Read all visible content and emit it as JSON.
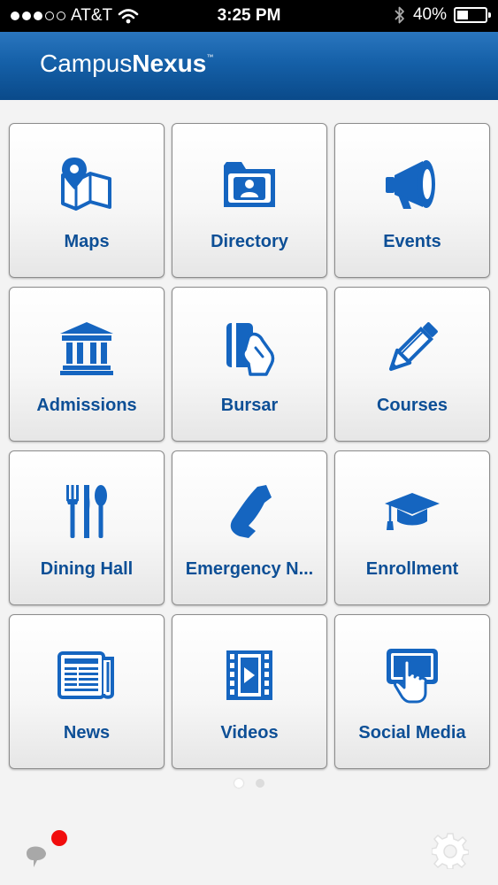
{
  "status_bar": {
    "carrier": "AT&T",
    "time": "3:25 PM",
    "battery": "40%",
    "battery_level": 0.4,
    "signal_bars": 3,
    "signal_total": 5
  },
  "header": {
    "brand_regular": "Campus",
    "brand_bold": "Nexus",
    "trademark": "™"
  },
  "tiles": [
    {
      "label": "Maps",
      "icon": "map-icon"
    },
    {
      "label": "Directory",
      "icon": "directory-folder-icon"
    },
    {
      "label": "Events",
      "icon": "megaphone-icon"
    },
    {
      "label": "Admissions",
      "icon": "building-icon"
    },
    {
      "label": "Bursar",
      "icon": "card-hand-icon"
    },
    {
      "label": "Courses",
      "icon": "pencil-icon"
    },
    {
      "label": "Dining Hall",
      "icon": "utensils-icon"
    },
    {
      "label": "Emergency N...",
      "icon": "phone-icon"
    },
    {
      "label": "Enrollment",
      "icon": "graduation-cap-icon"
    },
    {
      "label": "News",
      "icon": "newspaper-icon"
    },
    {
      "label": "Videos",
      "icon": "film-icon"
    },
    {
      "label": "Social Media",
      "icon": "touch-screen-icon"
    }
  ],
  "pager": {
    "pages": 2,
    "current": 1
  },
  "colors": {
    "accent": "#0d4f96",
    "icon_blue": "#1565c0",
    "header_top": "#2a76bf",
    "header_bottom": "#0a4a8a",
    "badge": "#f10d0d"
  }
}
